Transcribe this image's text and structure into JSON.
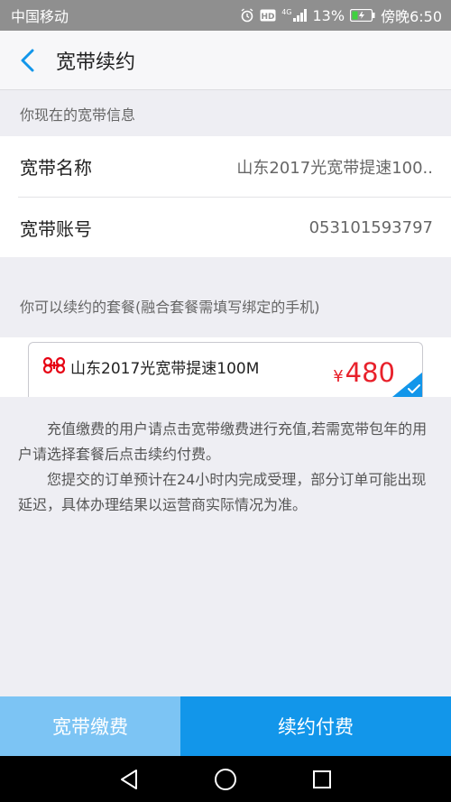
{
  "status_bar": {
    "carrier": "中国移动",
    "network": "4G",
    "battery": "13%",
    "time": "傍晚6:50"
  },
  "header": {
    "title": "宽带续约"
  },
  "current_info": {
    "section_label": "你现在的宽带信息",
    "rows": [
      {
        "key": "宽带名称",
        "value": "山东2017光宽带提速100.."
      },
      {
        "key": "宽带账号",
        "value": "053101593797"
      }
    ]
  },
  "packages": {
    "section_label": "你可以续约的套餐(融合套餐需填写绑定的手机)",
    "items": [
      {
        "name": "山东2017光宽带提速100M",
        "currency": "¥",
        "price": "480",
        "selected": true
      }
    ]
  },
  "notes": {
    "paragraphs": [
      "充值缴费的用户请点击宽带缴费进行充值,若需宽带包年的用户请选择套餐后点击续约付费。",
      "您提交的订单预计在24小时内完成受理，部分订单可能出现延迟，具体办理结果以运营商实际情况为准。"
    ]
  },
  "bottom_bar": {
    "left_label": "宽带缴费",
    "right_label": "续约付费"
  },
  "colors": {
    "primary": "#1296ea",
    "primary_light": "#7cc4f4",
    "price": "#e8212b",
    "logo": "#e60012"
  }
}
